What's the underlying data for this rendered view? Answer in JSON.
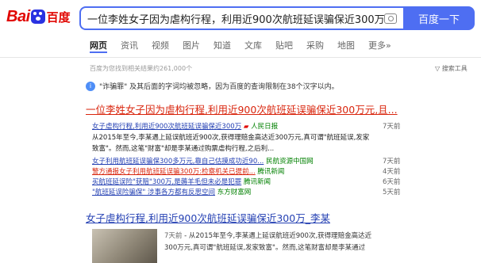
{
  "logo": {
    "bai": "Bai",
    "du": "du",
    "cn": "百度"
  },
  "search": {
    "query": "一位李姓女子因为虐构行程，利用近900次航班延误骗保近300万元，目",
    "button": "百度一下"
  },
  "tabs": [
    "网页",
    "资讯",
    "视频",
    "图片",
    "知道",
    "文库",
    "贴吧",
    "采购",
    "地图",
    "更多»"
  ],
  "result_info": "百度为您找到相关结果约261,000个",
  "tools": "搜索工具",
  "notice": "\"诈骗罪\" 及其后面的字词均被忽略，因为百度的查询限制在38个汉字以内。",
  "result1": {
    "title": "一位李姓女子因为虐构行程,利用近900次航班延误骗保近300万元,且..."
  },
  "news": [
    {
      "link": "女子虐构行程,利用近900次航班延误骗保近300万",
      "source": "人民日报",
      "time": "7天前"
    },
    {
      "link": "女子利用航班延误骗保300多万元,靠自己估摸成功近90...",
      "source": "民航资源中国网",
      "time": "7天前"
    },
    {
      "link": "警方通报女子利用航班延误骗300万:检察机关已提前...",
      "source": "腾讯新闻",
      "time": "4天前"
    },
    {
      "link": "买航班延误险\"获赔\"300万,是薅羊毛但未必是犯罪",
      "source": "腾讯新闻",
      "time": "6天前"
    },
    {
      "link": "\"航班延误险骗保\" 涉事各方都有反思空间",
      "source": "东方财富网",
      "time": "5天前"
    }
  ],
  "news_snippet": {
    "line1": "从2015年至今,李某遇上延误航班近900次,获得理赔金高达近300万元,真可谓\"航班延误,发家",
    "line2": "致富\"。然而,这笔\"财富\"却是李某通过购票虐构行程,之后利..."
  },
  "result2": {
    "title": "女子虐构行程,利用近900次航班延误骗保近300万_李某",
    "date": "7天前",
    "line1": " - 从2015年至今,李某遇上延误航班近900次,获得理赔金高达近",
    "line2": "300万元,真可谓\"航班延误,发家致富\"。然而,这笔财富却是李某通过"
  }
}
